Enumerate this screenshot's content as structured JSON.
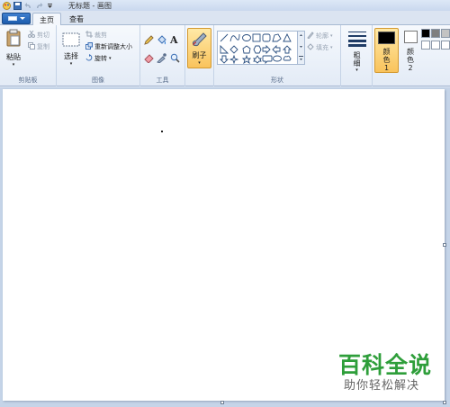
{
  "window": {
    "title": "无标题 - 画图"
  },
  "tabs": [
    {
      "label": "主页"
    },
    {
      "label": "查看"
    }
  ],
  "clipboard": {
    "paste_label": "粘贴",
    "cut_label": "剪切",
    "copy_label": "复制",
    "group_label": "剪贴板"
  },
  "image": {
    "select_label": "选择",
    "crop_label": "裁剪",
    "resize_label": "重新调整大小",
    "rotate_label": "旋转",
    "group_label": "图像"
  },
  "tools": {
    "group_label": "工具"
  },
  "brushes": {
    "label": "刷子"
  },
  "shapes": {
    "outline_label": "轮廓",
    "fill_label": "填充",
    "group_label": "形状"
  },
  "size": {
    "label": "粗细"
  },
  "colors": {
    "color1_label": "颜色 1",
    "color2_label": "颜色 2",
    "color1": "#000000",
    "color2": "#ffffff",
    "palette": [
      "#000000",
      "#7f7f7f",
      "#c3c3c3",
      "#ffffff",
      "#ffffff",
      "#ffffff"
    ]
  },
  "watermark": {
    "title": "百科全说",
    "subtitle": "助你轻松解决"
  }
}
